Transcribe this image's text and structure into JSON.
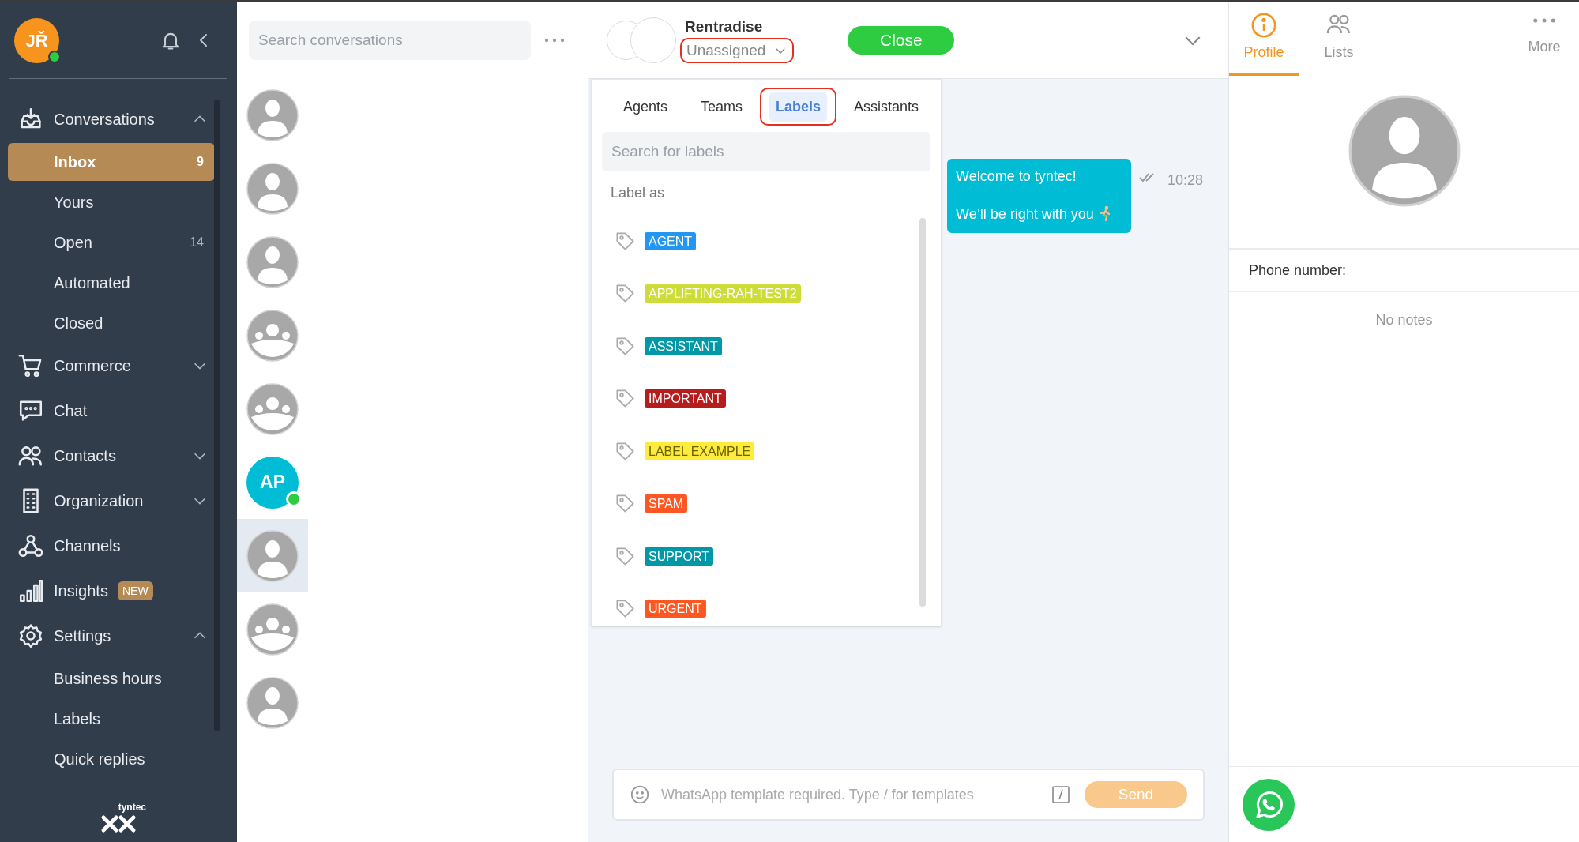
{
  "sidebar": {
    "user": {
      "initials": "JŘ",
      "online": true
    },
    "items": [
      {
        "kind": "section",
        "label": "Conversations",
        "expanded": true
      },
      {
        "kind": "sub",
        "label": "Inbox",
        "count": "9",
        "selected": true
      },
      {
        "kind": "sub",
        "label": "Yours",
        "selected": false
      },
      {
        "kind": "sub",
        "label": "Open",
        "count": "14",
        "selected": false
      },
      {
        "kind": "sub",
        "label": "Automated",
        "selected": false
      },
      {
        "kind": "sub",
        "label": "Closed",
        "selected": false
      },
      {
        "kind": "section",
        "label": "Commerce",
        "expanded": false
      },
      {
        "kind": "section",
        "label": "Chat"
      },
      {
        "kind": "section",
        "label": "Contacts",
        "expanded": false
      },
      {
        "kind": "section",
        "label": "Organization",
        "expanded": false
      },
      {
        "kind": "section",
        "label": "Channels"
      },
      {
        "kind": "section",
        "label": "Insights",
        "badge": "NEW"
      },
      {
        "kind": "section",
        "label": "Settings",
        "expanded": true
      },
      {
        "kind": "sub",
        "label": "Business hours",
        "selected": false
      },
      {
        "kind": "sub",
        "label": "Labels",
        "selected": false
      },
      {
        "kind": "sub",
        "label": "Quick replies",
        "selected": false
      }
    ],
    "logo": "tyntec"
  },
  "conversation_list": {
    "search": {
      "placeholder": "Search conversations"
    },
    "conversations": [
      {
        "kind": "person",
        "online": false,
        "selected": false
      },
      {
        "kind": "person",
        "online": false,
        "selected": false
      },
      {
        "kind": "person",
        "online": false,
        "selected": false
      },
      {
        "kind": "group",
        "online": false,
        "selected": false
      },
      {
        "kind": "group",
        "online": false,
        "selected": false
      },
      {
        "kind": "initials",
        "initials": "AP",
        "online": true,
        "selected": false
      },
      {
        "kind": "person",
        "online": false,
        "selected": true
      },
      {
        "kind": "group",
        "online": false,
        "selected": false
      },
      {
        "kind": "person",
        "online": false,
        "selected": false
      }
    ]
  },
  "chat": {
    "contact_name": "Rentradise",
    "assignee": {
      "label": "Unassigned",
      "highlighted": true
    },
    "close_button": "Close",
    "assign_menu": {
      "tabs": [
        {
          "label": "Agents",
          "selected": false,
          "highlighted": false
        },
        {
          "label": "Teams",
          "selected": false,
          "highlighted": false
        },
        {
          "label": "Labels",
          "selected": true,
          "highlighted": true
        },
        {
          "label": "Assistants",
          "selected": false,
          "highlighted": false
        }
      ],
      "search": {
        "placeholder": "Search for labels"
      },
      "section_title": "Label as",
      "labels": [
        {
          "name": "AGENT",
          "color": "#2196f3"
        },
        {
          "name": "APPLIFTING-RAH-TEST2",
          "color": "#cddc39"
        },
        {
          "name": "ASSISTANT",
          "color": "#0097a7"
        },
        {
          "name": "IMPORTANT",
          "color": "#b71c1c"
        },
        {
          "name": "LABEL EXAMPLE",
          "color": "#ffeb3b"
        },
        {
          "name": "SPAM",
          "color": "#ff5722"
        },
        {
          "name": "SUPPORT",
          "color": "#0097a7"
        },
        {
          "name": "URGENT",
          "color": "#ff5722"
        }
      ]
    },
    "messages": [
      {
        "text": "Welcome to tyntec!\n\nWe’ll be right with you",
        "time": "10:28",
        "read": true
      }
    ],
    "composer": {
      "placeholder": "WhatsApp template required. Type / for templates",
      "send": "Send",
      "send_disabled": true
    }
  },
  "profile_panel": {
    "tabs": [
      {
        "label": "Profile",
        "selected": true
      },
      {
        "label": "Lists",
        "selected": false
      },
      {
        "label": "More",
        "selected": false
      }
    ],
    "phone_label": "Phone number:",
    "notes_empty": "No notes"
  }
}
